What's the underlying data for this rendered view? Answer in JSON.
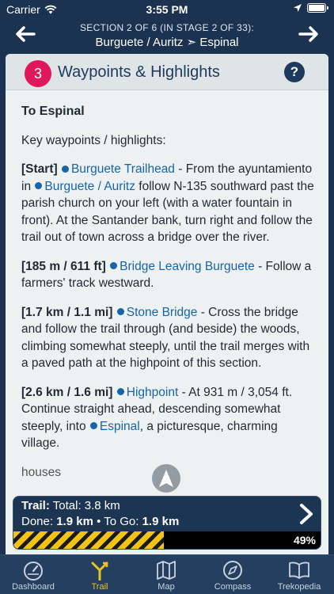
{
  "status_bar": {
    "carrier": "Carrier",
    "time": "3:55 PM"
  },
  "nav": {
    "subtitle": "SECTION 2 OF 6 (IN STAGE 2 OF 33):",
    "from": "Burguete / Auritz",
    "separator": "➣",
    "to": "Espinal"
  },
  "panel": {
    "badge": "3",
    "title": "Waypoints & Highlights",
    "help": "?"
  },
  "content": {
    "heading": "To Espinal",
    "intro": "Key waypoints / highlights:",
    "waypoints": [
      {
        "marker": "[Start]",
        "link": "Burguete Trailhead",
        "text1": " - From the ayuntamiento in ",
        "link2": "Burguete / Auritz",
        "text2": " follow N-135 southward past the parish church on your left (with a water fountain in front). At the Santander bank, turn right and follow the trail out of town across a bridge over the river."
      },
      {
        "marker": "[185 m / 611 ft]",
        "link": "Bridge Leaving Burguete",
        "text1": " - Follow a farmers' track westward."
      },
      {
        "marker": "[1.7 km / 1.1 mi]",
        "link": "Stone Bridge",
        "text1": " - Cross the bridge and follow the trail through (and beside) the woods, climbing somewhat steeply, until the trail merges with a paved path at the highpoint of this section."
      },
      {
        "marker": "[2.6 km / 1.6 mi]",
        "link": "Highpoint",
        "text1": " - At 931 m / 3,054 ft. Continue straight ahead, descending somewhat steeply, into ",
        "link2": "Espinal",
        "text2": ", a picturesque, charming village."
      }
    ],
    "tail": "houses"
  },
  "progress": {
    "trail_label": "Trail:",
    "trail_value": "Total: 3.8 km",
    "done_label": "Done:",
    "done_value": "1.9 km",
    "sep": " • ",
    "togo_label": "To Go:",
    "togo_value": "1.9 km",
    "percent_text": "49%",
    "fraction": 0.49
  },
  "tabs": [
    {
      "label": "Dashboard",
      "icon": "dashboard-icon"
    },
    {
      "label": "Trail",
      "icon": "trail-icon",
      "active": true
    },
    {
      "label": "Map",
      "icon": "map-icon"
    },
    {
      "label": "Compass",
      "icon": "compass-icon"
    },
    {
      "label": "Trekopedia",
      "icon": "book-icon"
    }
  ],
  "colors": {
    "background": "#1b3350",
    "badge": "#e0185b",
    "link": "#1764a6",
    "active_tab": "#e8c323",
    "progress_stripe": "#f2c314"
  }
}
